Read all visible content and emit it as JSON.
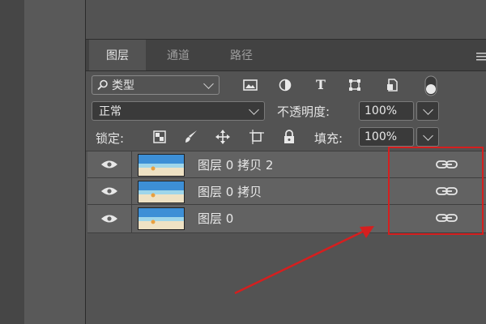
{
  "tabs": [
    {
      "label": "图层",
      "active": true
    },
    {
      "label": "通道",
      "active": false
    },
    {
      "label": "路径",
      "active": false
    }
  ],
  "panel_menu_icon": "hamburger-icon",
  "filter": {
    "label": "类型",
    "icon": "search-icon"
  },
  "filter_icons": [
    "image-filter-icon",
    "adjustment-filter-icon",
    "type-filter-icon",
    "shape-filter-icon",
    "smart-object-filter-icon",
    "filter-toggle-icon"
  ],
  "blend_mode": "正常",
  "opacity": {
    "label": "不透明度:",
    "value": "100%"
  },
  "lock": {
    "label": "锁定:",
    "icons": [
      "lock-transparent-icon",
      "lock-paint-icon",
      "lock-position-icon",
      "lock-artboard-icon",
      "lock-all-icon"
    ]
  },
  "fill": {
    "label": "填充:",
    "value": "100%"
  },
  "layers": [
    {
      "name": "图层 0 拷贝 2",
      "visible": true,
      "linked": true
    },
    {
      "name": "图层 0 拷贝",
      "visible": true,
      "linked": true
    },
    {
      "name": "图层 0",
      "visible": true,
      "linked": true
    }
  ],
  "highlight_color": "#d51f1f",
  "annotation_arrow_color": "#d51f1f"
}
